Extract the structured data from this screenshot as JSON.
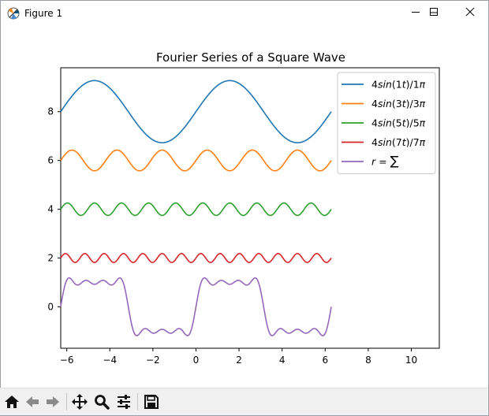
{
  "window": {
    "title": "Figure 1",
    "controls": {
      "minimize": "minimize",
      "maximize": "maximize",
      "close": "close"
    }
  },
  "toolbar": {
    "buttons": [
      "home-icon",
      "back-arrow-icon",
      "forward-arrow-icon",
      "pan-icon",
      "zoom-icon",
      "configure-subplots-icon",
      "save-icon"
    ]
  },
  "chart_data": {
    "type": "line",
    "title": "Fourier Series of a Square Wave",
    "xlabel": "",
    "ylabel": "",
    "xlim": [
      -6.28,
      11.3
    ],
    "ylim": [
      -1.7,
      9.8
    ],
    "xticks": [
      -6,
      -4,
      -2,
      0,
      2,
      4,
      6,
      8,
      10
    ],
    "yticks": [
      0,
      2,
      4,
      6,
      8
    ],
    "x_range": [
      -6.2832,
      6.2832
    ],
    "grid": false,
    "legend_position": "top-right",
    "series": [
      {
        "name": "4sin(1t)/1π",
        "label_parts": [
          "4",
          "sin",
          "(1",
          "t",
          ")/1",
          "π"
        ],
        "harmonic": 1,
        "offset": 8,
        "amplitude": 1.2732,
        "color": "#1f77b4"
      },
      {
        "name": "4sin(3t)/3π",
        "label_parts": [
          "4",
          "sin",
          "(3",
          "t",
          ")/3",
          "π"
        ],
        "harmonic": 3,
        "offset": 6,
        "amplitude": 0.4244,
        "color": "#ff7f0e"
      },
      {
        "name": "4sin(5t)/5π",
        "label_parts": [
          "4",
          "sin",
          "(5",
          "t",
          ")/5",
          "π"
        ],
        "harmonic": 5,
        "offset": 4,
        "amplitude": 0.2546,
        "color": "#2ca02c"
      },
      {
        "name": "4sin(7t)/7π",
        "label_parts": [
          "4",
          "sin",
          "(7",
          "t",
          ")/7",
          "π"
        ],
        "harmonic": 7,
        "offset": 2,
        "amplitude": 0.1819,
        "color": "#d62728"
      },
      {
        "name": "r = Σ",
        "label_parts": [
          "r",
          " = ",
          "∑"
        ],
        "harmonic": 0,
        "offset": 0,
        "sum_of_harmonics": [
          1,
          3,
          5,
          7
        ],
        "color": "#9467bd"
      }
    ]
  }
}
